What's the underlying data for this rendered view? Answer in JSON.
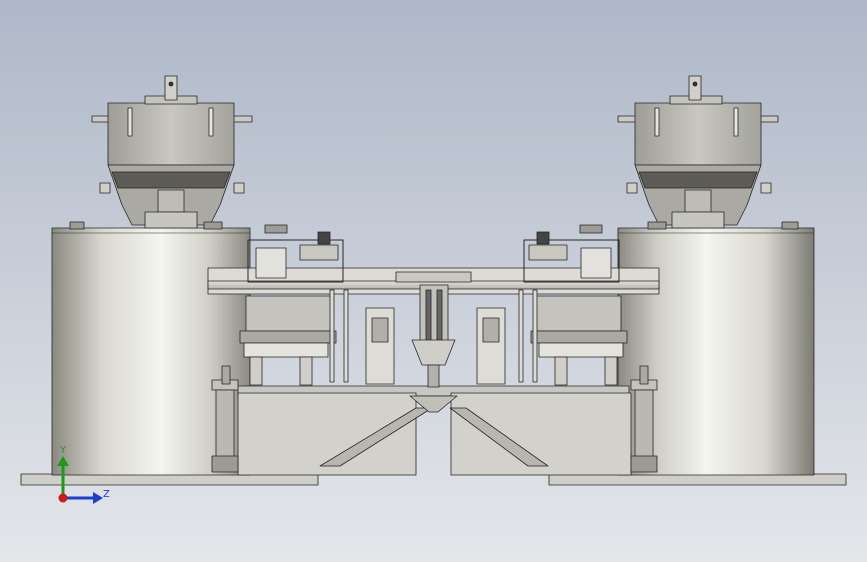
{
  "viewport": {
    "background_top": "#aeb8c8",
    "background_bottom": "#e4e6ea"
  },
  "colors": {
    "line": "#262626",
    "cylinder_light": "#f2f2ee",
    "cylinder_mid": "#bdbcb4",
    "cylinder_dark": "#7d7c74",
    "hopper_body": "#b8b7af",
    "hopper_band": "#5c5b55",
    "frame_gray": "#c7c6c0",
    "frame_light": "#dcdbd5",
    "plate": "#cfcec8",
    "x_axis": "#d01818",
    "y_axis": "#1a9a1a",
    "z_axis": "#1c3fd1"
  },
  "triad": {
    "y_label": "Y",
    "z_label": "Z"
  },
  "icons": {
    "triad": "coordinate-axes-triad-icon"
  }
}
